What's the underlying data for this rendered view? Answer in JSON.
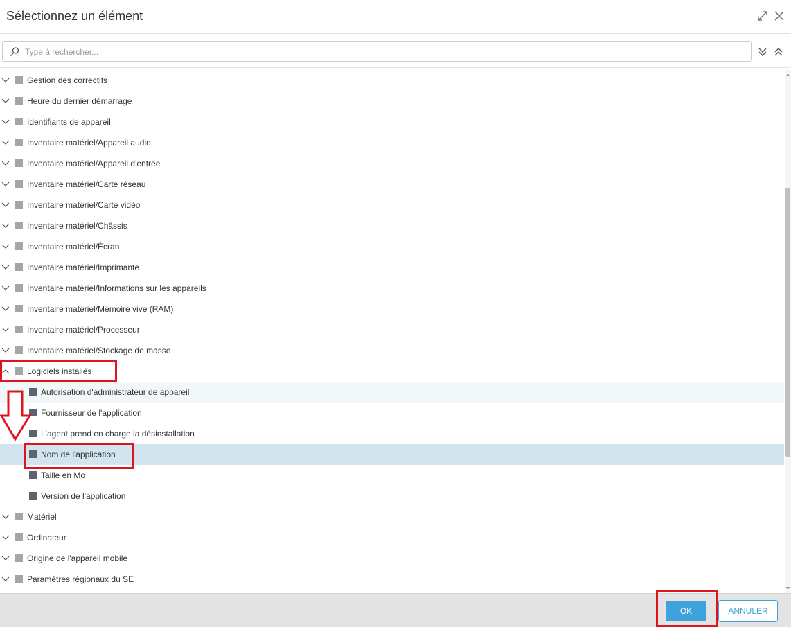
{
  "header": {
    "title": "Sélectionnez un élément",
    "expand_icon": "expand-icon",
    "close_icon": "close-icon"
  },
  "search": {
    "placeholder": "Type à rechercher...",
    "value": "",
    "icon": "search-icon",
    "expand_all_icon": "double-chevron-down-icon",
    "collapse_all_icon": "double-chevron-up-icon"
  },
  "tree": {
    "items": [
      {
        "label": "Gestion des correctifs",
        "level": 0,
        "expanded": false
      },
      {
        "label": "Heure du dernier démarrage",
        "level": 0,
        "expanded": false
      },
      {
        "label": "Identifiants de appareil",
        "level": 0,
        "expanded": false
      },
      {
        "label": "Inventaire matériel/Appareil audio",
        "level": 0,
        "expanded": false
      },
      {
        "label": "Inventaire matériel/Appareil d'entrée",
        "level": 0,
        "expanded": false
      },
      {
        "label": "Inventaire matériel/Carte réseau",
        "level": 0,
        "expanded": false
      },
      {
        "label": "Inventaire matériel/Carte vidéo",
        "level": 0,
        "expanded": false
      },
      {
        "label": "Inventaire matériel/Châssis",
        "level": 0,
        "expanded": false
      },
      {
        "label": "Inventaire matériel/Écran",
        "level": 0,
        "expanded": false
      },
      {
        "label": "Inventaire matériel/Imprimante",
        "level": 0,
        "expanded": false
      },
      {
        "label": "Inventaire matériel/Informations sur les appareils",
        "level": 0,
        "expanded": false
      },
      {
        "label": "Inventaire matériel/Mémoire vive (RAM)",
        "level": 0,
        "expanded": false
      },
      {
        "label": "Inventaire matériel/Processeur",
        "level": 0,
        "expanded": false
      },
      {
        "label": "Inventaire matériel/Stockage de masse",
        "level": 0,
        "expanded": false
      },
      {
        "label": "Logiciels installés",
        "level": 0,
        "expanded": true
      },
      {
        "label": "Autorisation d'administrateur de appareil",
        "level": 1
      },
      {
        "label": "Fournisseur de l'application",
        "level": 1
      },
      {
        "label": "L'agent prend en charge la désinstallation",
        "level": 1
      },
      {
        "label": "Nom de l'application",
        "level": 1,
        "selected": true
      },
      {
        "label": "Taille en Mo",
        "level": 1
      },
      {
        "label": "Version de l'application",
        "level": 1
      },
      {
        "label": "Matériel",
        "level": 0,
        "expanded": false
      },
      {
        "label": "Ordinateur",
        "level": 0,
        "expanded": false
      },
      {
        "label": "Origine de l'appareil mobile",
        "level": 0,
        "expanded": false
      },
      {
        "label": "Paramètres régionaux du SE",
        "level": 0,
        "expanded": false
      }
    ]
  },
  "footer": {
    "ok_label": "OK",
    "cancel_label": "ANNULER"
  },
  "colors": {
    "accent": "#3ea3dd",
    "selected_row": "#d2e4ee",
    "annotation": "#e0141e"
  }
}
